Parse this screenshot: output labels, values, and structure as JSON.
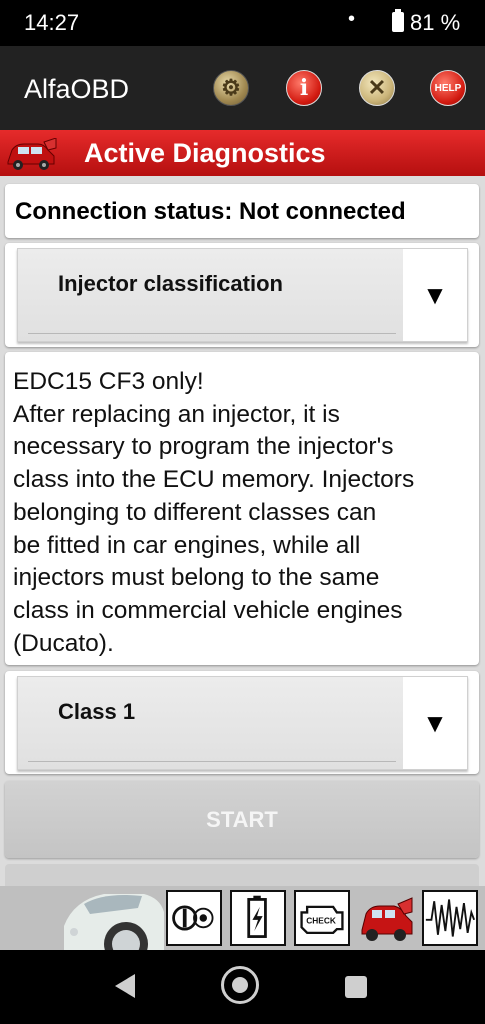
{
  "status_bar": {
    "time": "14:27",
    "dot": "•",
    "battery_percent": "81 %",
    "battery_icon": "battery-icon"
  },
  "app_bar": {
    "title": "AlfaOBD",
    "buttons": [
      {
        "icon": "gear-icon",
        "glyph": "⚙"
      },
      {
        "icon": "info-icon",
        "glyph": "i"
      },
      {
        "icon": "tools-icon",
        "glyph": "✕"
      },
      {
        "icon": "help-icon",
        "glyph": "HELP"
      }
    ]
  },
  "banner": {
    "title": "Active Diagnostics",
    "icon": "car-icon",
    "colors": {
      "banner": "#d91e1e"
    }
  },
  "connection": {
    "status_text": "Connection status: Not connected"
  },
  "procedure_select": {
    "value": "Injector classification",
    "arrow": "▼"
  },
  "description": {
    "lines": [
      "EDC15 CF3 only!",
      "After replacing an injector, it is",
      "necessary to program the injector's",
      "class into the ECU memory. Injectors",
      "belonging to different classes can",
      "be fitted in car engines, while all",
      "injectors must belong to the same",
      "class in commercial vehicle engines",
      "(Ducato)."
    ]
  },
  "class_select": {
    "value": "Class 1",
    "arrow": "▼"
  },
  "start_button": {
    "label": "START"
  },
  "bottom_toolbar": {
    "icons": [
      "car-front-icon",
      "ignition-key-icon",
      "battery-voltage-icon",
      "check-engine-icon",
      "car-diagnostics-icon",
      "waveform-icon"
    ],
    "check_text": "CHECK"
  },
  "nav_bar": {
    "icons": [
      "back-icon",
      "home-icon",
      "recents-icon"
    ]
  }
}
